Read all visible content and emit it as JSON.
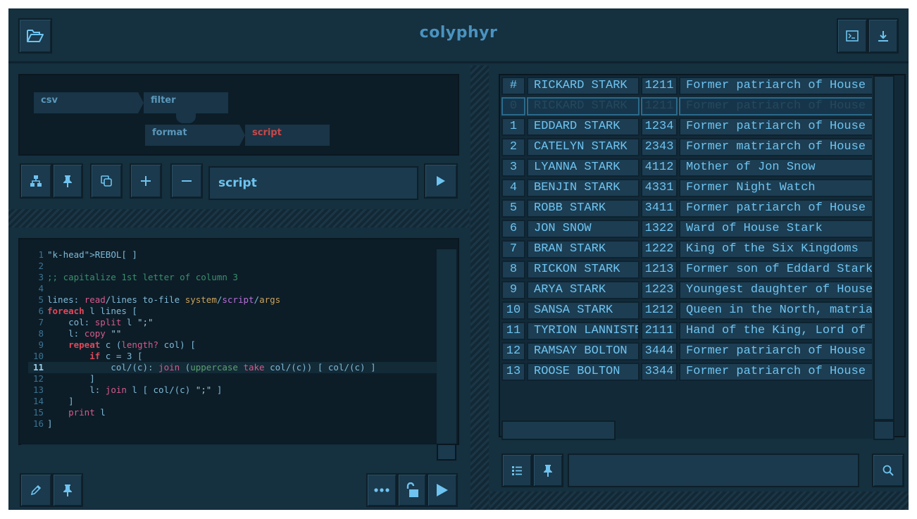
{
  "app": {
    "title": "colyphyr"
  },
  "pipeline": {
    "nodes": [
      {
        "label": "csv",
        "selected": false
      },
      {
        "label": "filter",
        "selected": false
      },
      {
        "label": "format",
        "selected": false
      },
      {
        "label": "script",
        "selected": true
      }
    ],
    "current_node_name": "script"
  },
  "icons": {
    "open": "folder-open-icon",
    "terminal": "terminal-icon",
    "download": "download-icon",
    "tree": "sitemap-icon",
    "pin": "pin-icon",
    "copy": "copy-icon",
    "add": "plus-icon",
    "remove": "minus-icon",
    "play": "play-icon",
    "edit": "pencil-icon",
    "more": "ellipsis-icon",
    "unlock": "unlock-icon",
    "list": "list-icon",
    "search": "search-icon"
  },
  "code": {
    "current_line": 11,
    "lines": [
      {
        "n": "1",
        "text": "REBOL[ ]"
      },
      {
        "n": "2",
        "text": ""
      },
      {
        "n": "3",
        "text": ";; capitalize 1st letter of column 3"
      },
      {
        "n": "4",
        "text": ""
      },
      {
        "n": "5",
        "text": "lines: read/lines to-file system/script/args"
      },
      {
        "n": "6",
        "text": "foreach l lines ["
      },
      {
        "n": "7",
        "text": "    col: split l \";\""
      },
      {
        "n": "8",
        "text": "    l: copy \"\""
      },
      {
        "n": "9",
        "text": "    repeat c (length? col) ["
      },
      {
        "n": "10",
        "text": "        if c = 3 ["
      },
      {
        "n": "11",
        "text": "            col/(c): join (uppercase take col/(c)) [ col/(c) ]"
      },
      {
        "n": "12",
        "text": "        ]"
      },
      {
        "n": "13",
        "text": "        l: join l [ col/(c) \";\" ]"
      },
      {
        "n": "14",
        "text": "    ]"
      },
      {
        "n": "15",
        "text": "    print l"
      },
      {
        "n": "16",
        "text": "]"
      }
    ]
  },
  "table": {
    "header": [
      "#",
      "RICKARD STARK",
      "1211",
      "Former patriarch of House Stark"
    ],
    "rows": [
      [
        "0",
        "RICKARD STARK",
        "1211",
        "Former patriarch of House Stark"
      ],
      [
        "1",
        "EDDARD STARK",
        "1234",
        "Former patriarch of House Stark"
      ],
      [
        "2",
        "CATELYN STARK",
        "2343",
        "Former matriarch of House Stark"
      ],
      [
        "3",
        "LYANNA STARK",
        "4112",
        "Mother of Jon Snow"
      ],
      [
        "4",
        "BENJIN STARK",
        "4331",
        "Former Night Watch"
      ],
      [
        "5",
        "ROBB STARK",
        "3411",
        "Former patriarch of House Stark"
      ],
      [
        "6",
        "JON SNOW",
        "1322",
        "Ward of House Stark"
      ],
      [
        "7",
        "BRAN STARK",
        "1222",
        "King of the Six Kingdoms"
      ],
      [
        "8",
        "RICKON STARK",
        "1213",
        "Former son of Eddard Stark"
      ],
      [
        "9",
        "ARYA STARK",
        "1223",
        "Youngest daughter of House Stark"
      ],
      [
        "10",
        "SANSA STARK",
        "1212",
        "Queen in the North, matriarch"
      ],
      [
        "11",
        "TYRION LANNISTER",
        "2111",
        "Hand of the King, Lord of Casterly Rock"
      ],
      [
        "12",
        "RAMSAY BOLTON",
        "3444",
        "Former patriarch of House Bolton"
      ],
      [
        "13",
        "ROOSE BOLTON",
        "3344",
        "Former patriarch of House Bolton"
      ]
    ]
  },
  "search": {
    "value": ""
  },
  "colors": {
    "accent": "#6ec3f0",
    "background": "#15303f",
    "selected_node": "#c8484a"
  }
}
